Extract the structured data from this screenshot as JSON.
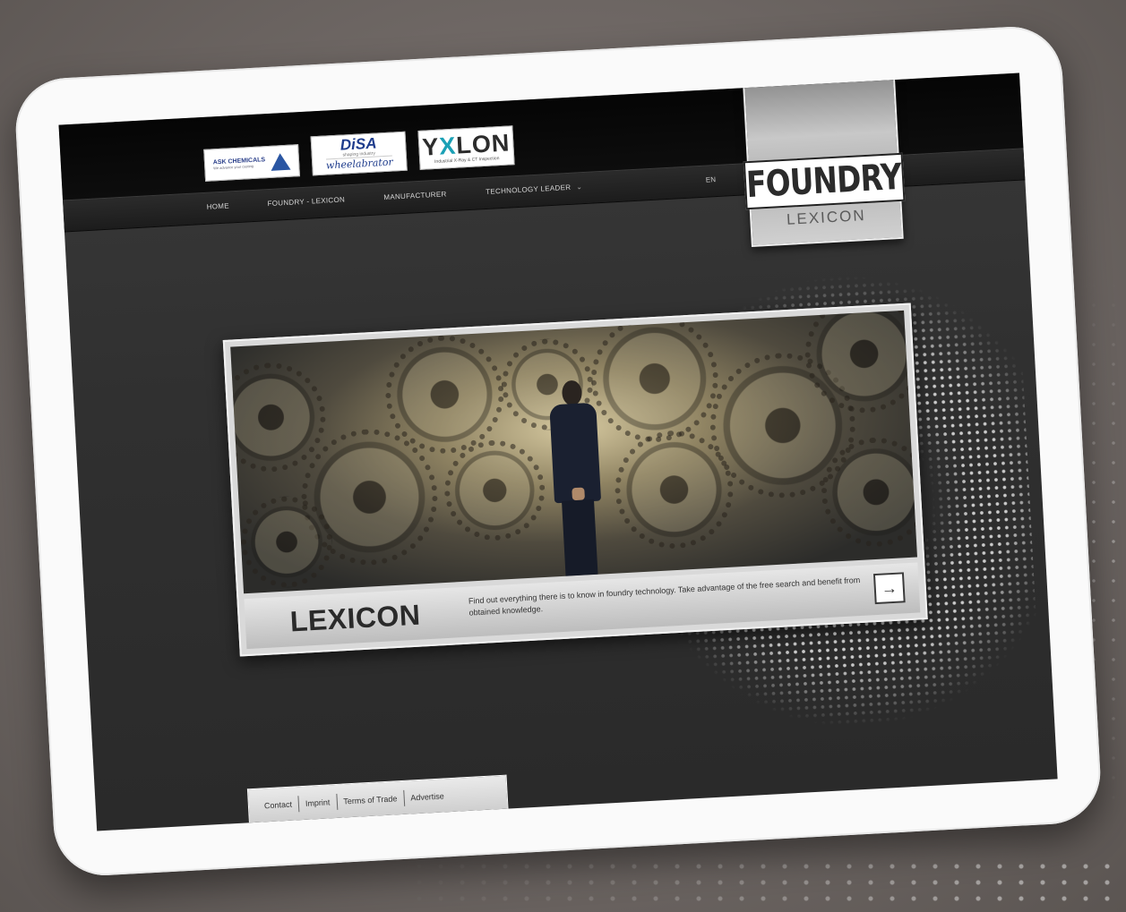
{
  "sponsors": {
    "ask": {
      "name": "ASK CHEMICALS",
      "tagline": "We advance your casting"
    },
    "disa": {
      "name": "DiSA",
      "tagline": "shaping industry",
      "sub": "wheelabrator"
    },
    "yxlon": {
      "name_a": "Y",
      "name_x": "X",
      "name_b": "LON",
      "tagline": "Industrial X-Ray & CT Inspection"
    }
  },
  "nav": {
    "items": [
      {
        "label": "HOME"
      },
      {
        "label": "FOUNDRY - LEXICON"
      },
      {
        "label": "MANUFACTURER"
      },
      {
        "label": "TECHNOLOGY LEADER"
      }
    ],
    "chevron": "⌄",
    "language": "EN"
  },
  "brand": {
    "title": "FOUNDRY",
    "subtitle": "LEXICON"
  },
  "hero": {
    "title": "LEXICON",
    "description": "Find out everything there is to know in foundry technology. Take advantage of the free search and benefit from obtained knowledge.",
    "arrow": "→"
  },
  "footer": {
    "links": [
      "Contact",
      "Imprint",
      "Terms of Trade",
      "Advertise"
    ]
  },
  "colors": {
    "background": "#6e6764",
    "screen": "#303030",
    "header": "#0d0d0d"
  }
}
